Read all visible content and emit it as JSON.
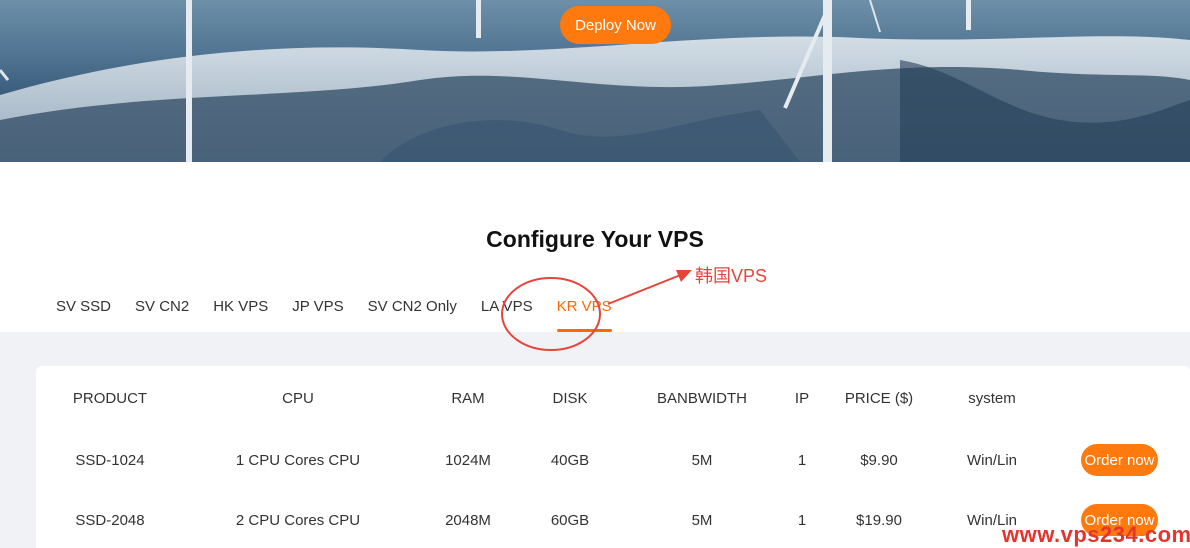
{
  "hero": {
    "deploy_label": "Deploy Now"
  },
  "section": {
    "title": "Configure Your VPS"
  },
  "tabs": [
    {
      "label": "SV SSD"
    },
    {
      "label": "SV CN2"
    },
    {
      "label": "HK VPS"
    },
    {
      "label": "JP VPS"
    },
    {
      "label": "SV CN2 Only"
    },
    {
      "label": "LA VPS"
    },
    {
      "label": "KR VPS",
      "active": true
    }
  ],
  "annotation": {
    "label": "韩国VPS"
  },
  "table": {
    "headers": [
      "PRODUCT",
      "CPU",
      "RAM",
      "DISK",
      "BANBWIDTH",
      "IP",
      "PRICE ($)",
      "system"
    ],
    "rows": [
      {
        "product": "SSD-1024",
        "cpu": "1 CPU Cores CPU",
        "ram": "1024M",
        "disk": "40GB",
        "bandwidth": "5M",
        "ip": "1",
        "price": "$9.90",
        "system": "Win/Lin",
        "order_label": "Order now"
      },
      {
        "product": "SSD-2048",
        "cpu": "2 CPU Cores CPU",
        "ram": "2048M",
        "disk": "60GB",
        "bandwidth": "5M",
        "ip": "1",
        "price": "$19.90",
        "system": "Win/Lin",
        "order_label": "Order now"
      }
    ]
  },
  "watermark": "www.vps234.com",
  "colors": {
    "accent": "#ff7a0e",
    "active_tab": "#ff6a00",
    "annotation": "#e8443a"
  }
}
